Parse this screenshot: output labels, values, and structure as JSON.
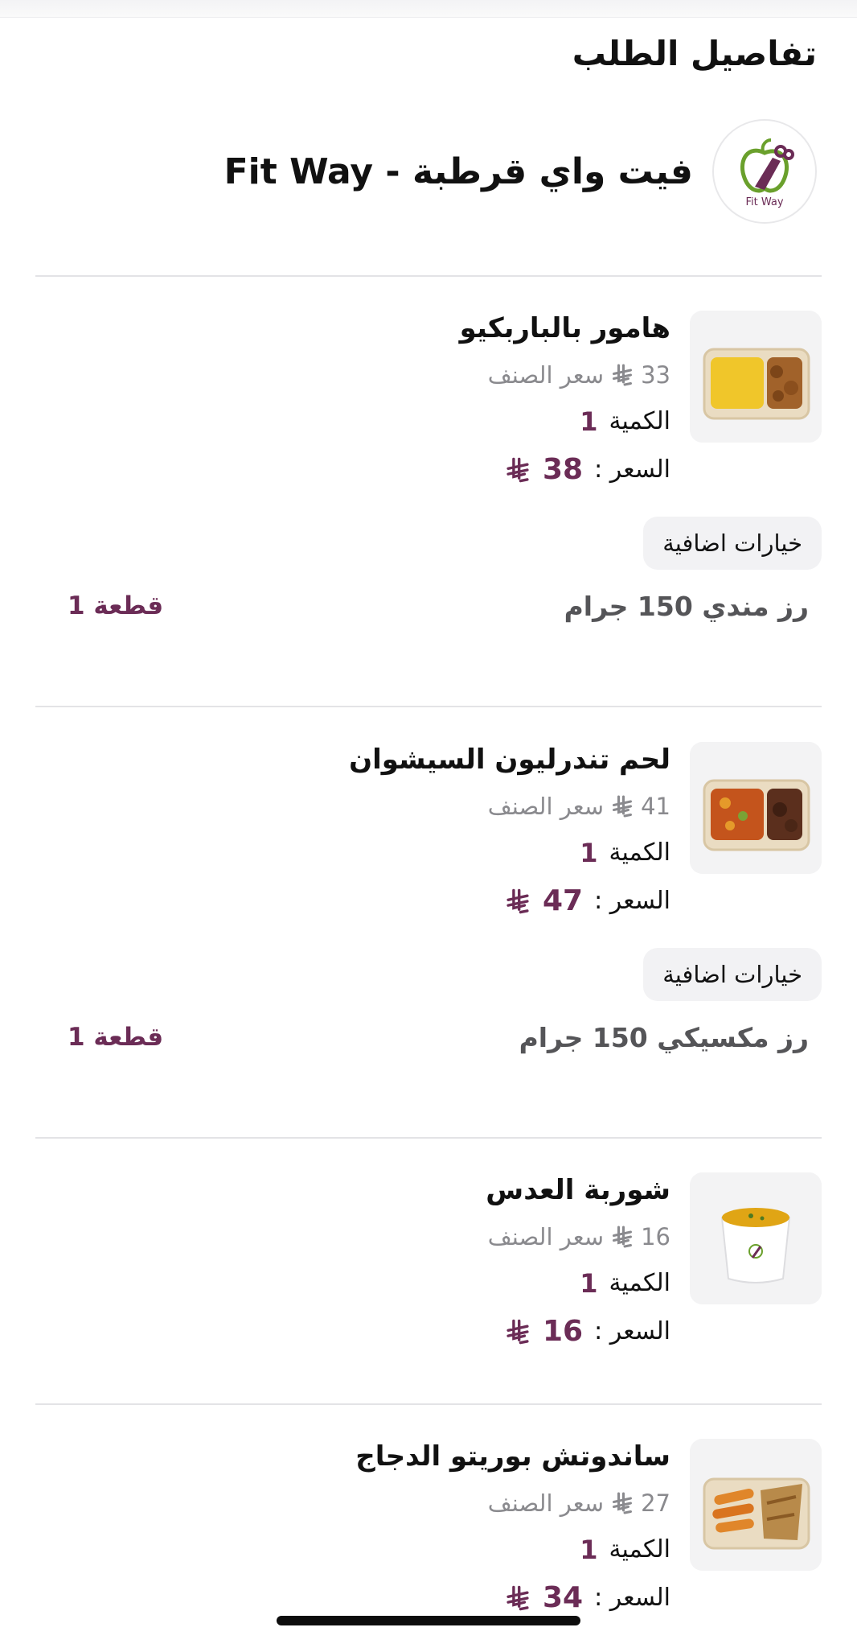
{
  "header": {
    "title": "تفاصيل الطلب"
  },
  "restaurant": {
    "name": "فيت واي قرطبة - Fit Way",
    "logo_text": "Fit Way",
    "logo_icon": "apple-fork-logo"
  },
  "labels": {
    "unit_price": "سعر الصنف",
    "quantity": "الكمية",
    "price": "السعر :",
    "extra_options": "خيارات اضافية",
    "currency_icon": "riyal-icon"
  },
  "colors": {
    "accent": "#6b2c56",
    "muted": "#8a8a8e",
    "chip_bg": "#f2f2f4",
    "divider": "#e3e3e6"
  },
  "items": [
    {
      "name": "هامور بالباربكيو",
      "unit_price": "33",
      "quantity": "1",
      "price": "38",
      "addon": {
        "name": "رز مندي 150 جرام",
        "qty": "قطعة 1"
      }
    },
    {
      "name": "لحم تندرليون السيشوان",
      "unit_price": "41",
      "quantity": "1",
      "price": "47",
      "addon": {
        "name": "رز مكسيكي 150 جرام",
        "qty": "قطعة 1"
      }
    },
    {
      "name": "شوربة العدس",
      "unit_price": "16",
      "quantity": "1",
      "price": "16"
    },
    {
      "name": "ساندوتش بوريتو الدجاج",
      "unit_price": "27",
      "quantity": "1",
      "price": "34"
    }
  ]
}
